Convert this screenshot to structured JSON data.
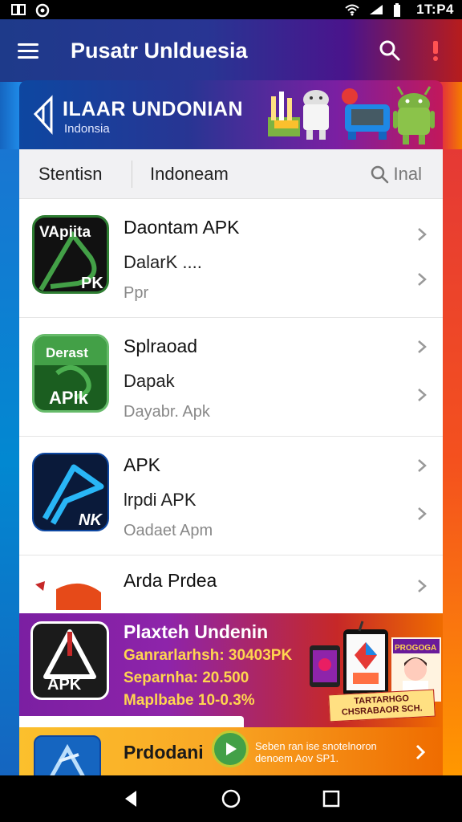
{
  "status_bar": {
    "time": "1T:P4"
  },
  "app_bar": {
    "title": "Pusatr Unlduesia"
  },
  "banner": {
    "title": "ILAAR UNDONIAN",
    "subtitle": "Indonsia"
  },
  "filters": {
    "tab_a": "Stentisn",
    "tab_b": "Indoneam",
    "search_label": "Inal"
  },
  "apps": [
    {
      "line1": "Daontam APK",
      "line2": "DalarK  ....",
      "line3": "Ppr",
      "icon_text_top": "VApiita",
      "icon_text_bottom": "PK",
      "icon": "apk-green-icon"
    },
    {
      "line1": "Splraoad",
      "line2": "Dapak",
      "line3": "Dayabr. Apk",
      "icon_text_top": "Derast",
      "icon_text_bottom": "APlk",
      "icon": "apk-download-icon"
    },
    {
      "line1": "APK",
      "line2": "lrpdi APK",
      "line3": "Oadaet Apm",
      "icon_text_top": "",
      "icon_text_bottom": "NK",
      "icon": "apk-neon-icon"
    },
    {
      "line1": "Arda Prdea",
      "line2": "",
      "line3": "",
      "icon": "apk-flag-icon"
    }
  ],
  "promo": {
    "title": "Plaxteh Undenin",
    "line1": "Ganrarlarhsh: 30403PK",
    "line2": "Separnha: 20.500",
    "line3": "Maplbabe 10-0.3%",
    "icon_text": "APK",
    "overlay_text": "TARTARHGO CHSRABAOR SCH.",
    "sign_text": "PROGOGA"
  },
  "bottom_card": {
    "title": "Prdodani",
    "text": "Seben ran ise snotelnoron denoem Aov SP1."
  },
  "colors": {
    "accent_green": "#43a047",
    "alert_red": "#ff5252"
  }
}
